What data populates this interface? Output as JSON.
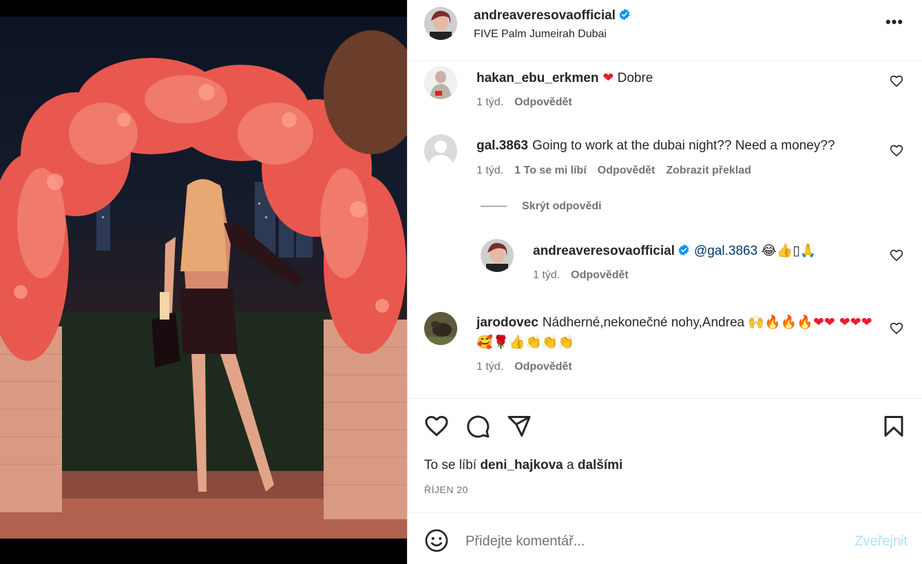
{
  "post": {
    "author": "andreaveresovaofficial",
    "location": "FIVE Palm Jumeirah Dubai",
    "more_label": "•••"
  },
  "comments": [
    {
      "user": "hakan_ebu_erkmen",
      "text_emoji": "❤",
      "text": "Dobre",
      "time": "1 týd.",
      "reply": "Odpovědět"
    },
    {
      "user": "gal.3863",
      "text": "Going to work at the dubai night?? Need a money??",
      "time": "1 týd.",
      "likes": "1 To se mi líbí",
      "reply": "Odpovědět",
      "translate": "Zobrazit překlad",
      "hide_replies": "Skrýt odpovědi",
      "replies": [
        {
          "user": "andreaveresovaofficial",
          "mention": "@gal.3863",
          "emojis": "😂👍▯🙏",
          "time": "1 týd.",
          "reply": "Odpovědět"
        }
      ]
    },
    {
      "user": "jarodovec",
      "text": "Nádherné,nekonečné nohy,Andrea",
      "emojis": "🙌🔥🔥🔥❤❤ ❤❤❤🥰🌹👍👏👏👏",
      "time": "1 týd.",
      "reply": "Odpovědět"
    }
  ],
  "actions": {
    "likes_prefix": "To se líbí",
    "likes_user": "deni_hajkova",
    "likes_and": "a",
    "likes_others": "dalšími",
    "date": "ŘÍJEN 20"
  },
  "compose": {
    "placeholder": "Přidejte komentář...",
    "post_label": "Zveřejnit"
  },
  "colors": {
    "accent": "#0095f6",
    "verified": "#0095f6",
    "post_disabled": "#b2dffc",
    "heart": "#ed1a2c",
    "muted": "#737373"
  },
  "icons": [
    "verified-badge-icon",
    "more-options-icon",
    "heart-icon",
    "comment-icon",
    "share-icon",
    "bookmark-icon",
    "emoji-icon"
  ]
}
